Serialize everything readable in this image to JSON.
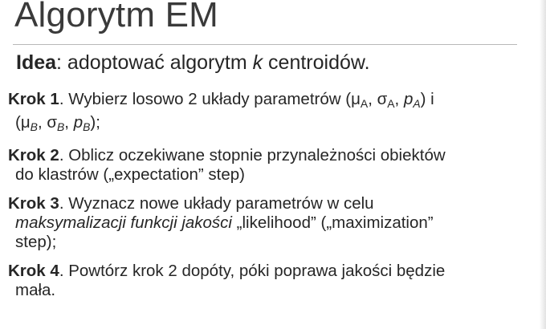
{
  "slide": {
    "title": "Algorytm EM",
    "idea": {
      "label": "Idea",
      "text_before": ": adoptować algorytm ",
      "k": "k",
      "text_after": " centroidów."
    },
    "steps": [
      {
        "label": "Krok 1",
        "parts": [
          {
            "t": ". Wybierz losowo 2 układy parametrów ("
          },
          {
            "t": "μ"
          },
          {
            "t": "A",
            "sub": true,
            "upright": true
          },
          {
            "t": ", σ"
          },
          {
            "t": "A",
            "sub": true,
            "upright": true
          },
          {
            "t": ", "
          },
          {
            "t": "p",
            "i": true
          },
          {
            "t": "A",
            "sub": true
          },
          {
            "t": ") i"
          }
        ],
        "cont": [
          {
            "t": "(μ"
          },
          {
            "t": "B",
            "sub": true
          },
          {
            "t": ", σ"
          },
          {
            "t": "B",
            "sub": true
          },
          {
            "t": ", "
          },
          {
            "t": "p",
            "i": true
          },
          {
            "t": "B",
            "sub": true
          },
          {
            "t": ");"
          }
        ]
      },
      {
        "label": "Krok 2",
        "parts": [
          {
            "t": ". Oblicz oczekiwane stopnie przynależności obiektów"
          }
        ],
        "cont": [
          {
            "t": "do klastrów („expectation” step)"
          }
        ]
      },
      {
        "label": "Krok 3",
        "parts": [
          {
            "t": ". Wyznacz nowe układy parametrów w celu"
          }
        ],
        "cont": [
          {
            "t": "maksymalizacji funkcji jakości",
            "i": true
          },
          {
            "t": " „likelihood” („maximization”"
          },
          {
            "br": true
          },
          {
            "t": "step);"
          }
        ]
      },
      {
        "label": "Krok 4",
        "parts": [
          {
            "t": ". Powtórz krok 2 dopóty, póki poprawa jakości będzie"
          }
        ],
        "cont": [
          {
            "t": "mała."
          }
        ]
      }
    ]
  }
}
